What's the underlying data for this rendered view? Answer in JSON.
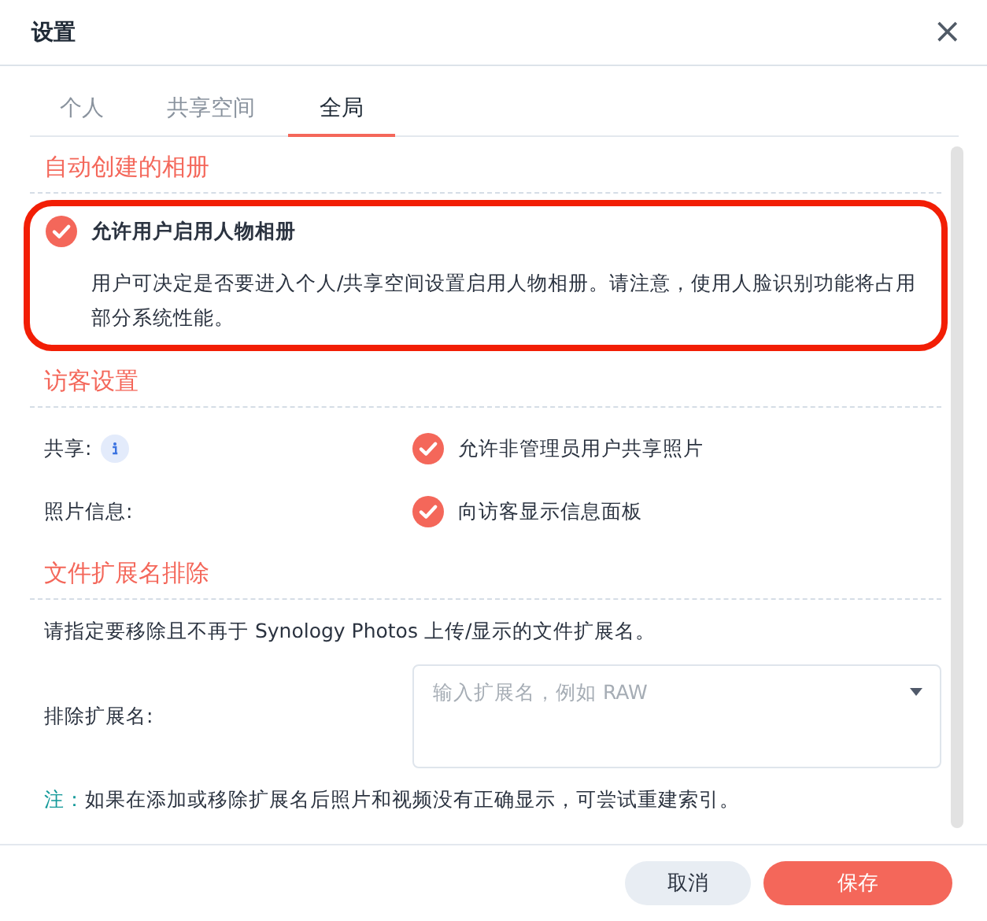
{
  "window": {
    "title": "设置",
    "close": "×"
  },
  "tabs": [
    {
      "label": "个人",
      "selected": false
    },
    {
      "label": "共享空间",
      "selected": false
    },
    {
      "label": "全局",
      "selected": true
    }
  ],
  "sections": [
    {
      "title": "自动创建的相册",
      "items": [
        {
          "kind": "checkbox",
          "label": "允许用户启用人物相册",
          "checked": true,
          "highlighted": true,
          "description": "用户可决定是否要进入个人/共享空间设置启用人物相册。请注意，使用人脸识别功能将占用部分系统性能。"
        }
      ]
    },
    {
      "title": "访客设置",
      "items": [
        {
          "kind": "labeled_checkbox",
          "field_label": "共享:",
          "info": true,
          "label": "允许非管理员用户共享照片",
          "checked": true
        },
        {
          "kind": "labeled_checkbox",
          "field_label": "照片信息:",
          "info": false,
          "label": "向访客显示信息面板",
          "checked": true
        }
      ]
    },
    {
      "title": "文件扩展名排除",
      "items": [
        {
          "kind": "text",
          "text": "请指定要移除且不再于 Synology Photos 上传/显示的文件扩展名。"
        },
        {
          "kind": "tag_field",
          "field_label": "排除扩展名:",
          "placeholder": "输入扩展名，例如 RAW"
        },
        {
          "kind": "note",
          "note_label": "注：",
          "text": "如果在添加或移除扩展名后照片和视频没有正确显示，可尝试重建索引。"
        }
      ]
    }
  ],
  "buttons": [
    {
      "label": "取消",
      "kind": "secondary"
    },
    {
      "label": "保存",
      "kind": "primary"
    }
  ]
}
